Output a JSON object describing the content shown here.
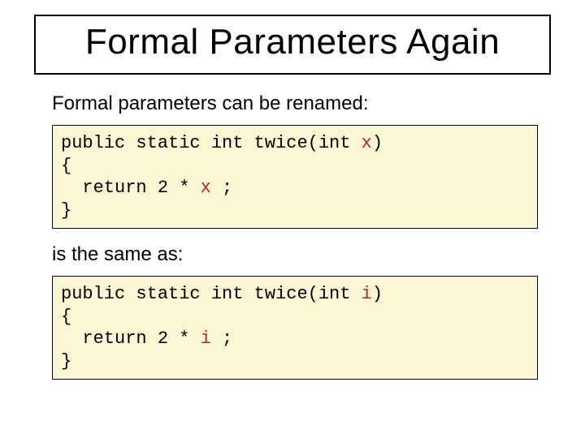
{
  "title": "Formal Parameters Again",
  "intro": "Formal parameters can be renamed:",
  "between": "is the same as:",
  "code1": {
    "sig_prefix": "public static int twice(int ",
    "param": "x",
    "sig_suffix": ")",
    "open": "{",
    "ret_prefix": "  return 2 * ",
    "ret_param": "x",
    "ret_suffix": " ;",
    "close": "}"
  },
  "code2": {
    "sig_prefix": "public static int twice(int ",
    "param": "i",
    "sig_suffix": ")",
    "open": "{",
    "ret_prefix": "  return 2 * ",
    "ret_param": "i",
    "ret_suffix": " ;",
    "close": "}"
  }
}
